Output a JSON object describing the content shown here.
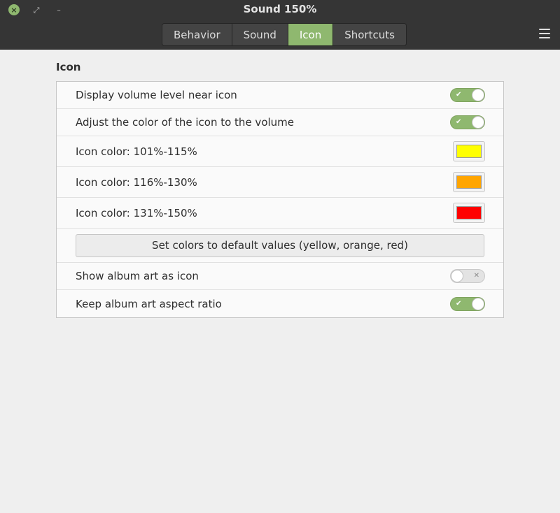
{
  "window": {
    "title": "Sound 150%"
  },
  "window_controls": {
    "close": "×",
    "maximize": "⤢",
    "minimize": "–"
  },
  "tabs": [
    {
      "label": "Behavior",
      "active": false
    },
    {
      "label": "Sound",
      "active": false
    },
    {
      "label": "Icon",
      "active": true
    },
    {
      "label": "Shortcuts",
      "active": false
    }
  ],
  "menu_icon": "hamburger-menu-icon",
  "section": {
    "title": "Icon"
  },
  "settings": {
    "display_volume": {
      "label": "Display volume level near icon",
      "enabled": true
    },
    "adjust_color": {
      "label": "Adjust the color of the icon to the volume",
      "enabled": true
    },
    "color_1": {
      "label": "Icon color: 101%-115%",
      "color": "#ffff00"
    },
    "color_2": {
      "label": "Icon color: 116%-130%",
      "color": "#ffa500"
    },
    "color_3": {
      "label": "Icon color: 131%-150%",
      "color": "#ff0000"
    },
    "reset_button": {
      "label": "Set colors to default values (yellow, orange, red)"
    },
    "album_art": {
      "label": "Show album art as icon",
      "enabled": false
    },
    "aspect_ratio": {
      "label": "Keep album art aspect ratio",
      "enabled": true
    }
  },
  "switch_marks": {
    "on": "✔",
    "off": "✕"
  },
  "colors": {
    "accent": "#8fb86f",
    "titlebar": "#353535",
    "background": "#efefef"
  }
}
